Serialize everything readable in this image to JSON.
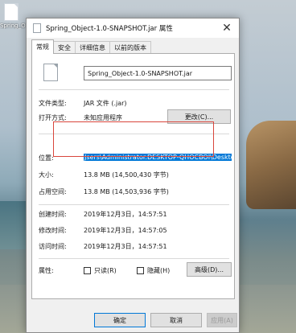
{
  "desktop": {
    "icon_label": "Spring_O"
  },
  "window": {
    "title": "Spring_Object-1.0-SNAPSHOT.jar 属性",
    "close_symbol": "✕"
  },
  "tabs": [
    {
      "label": "常规",
      "active": true
    },
    {
      "label": "安全",
      "active": false
    },
    {
      "label": "详细信息",
      "active": false
    },
    {
      "label": "以前的版本",
      "active": false
    }
  ],
  "general": {
    "file_name": "Spring_Object-1.0-SNAPSHOT.jar",
    "rows": {
      "file_type": {
        "label": "文件类型:",
        "value": "JAR 文件 (.jar)"
      },
      "opens_with": {
        "label": "打开方式:",
        "value": "未知应用程序",
        "button": "更改(C)..."
      },
      "location": {
        "label": "位置:",
        "value": "Jsers\\Administrator.DESKTOP-QHOCBOI\\Desktop"
      },
      "size": {
        "label": "大小:",
        "value": "13.8 MB (14,500,430 字节)"
      },
      "size_on_disk": {
        "label": "占用空间:",
        "value": "13.8 MB (14,503,936 字节)"
      },
      "created": {
        "label": "创建时间:",
        "value": "2019年12月3日，14:57:51"
      },
      "modified": {
        "label": "修改时间:",
        "value": "2019年12月3日，14:57:05"
      },
      "accessed": {
        "label": "访问时间:",
        "value": "2019年12月3日，14:57:51"
      }
    },
    "attributes": {
      "label": "属性:",
      "readonly": {
        "label": "只读(R)",
        "checked": false
      },
      "hidden": {
        "label": "隐藏(H)",
        "checked": false
      },
      "advanced_button": "高级(D)..."
    }
  },
  "footer": {
    "ok": "确定",
    "cancel": "取消",
    "apply": "应用(A)"
  },
  "colors": {
    "selection": "#0078d7",
    "highlight_rect": "#d9463c"
  }
}
